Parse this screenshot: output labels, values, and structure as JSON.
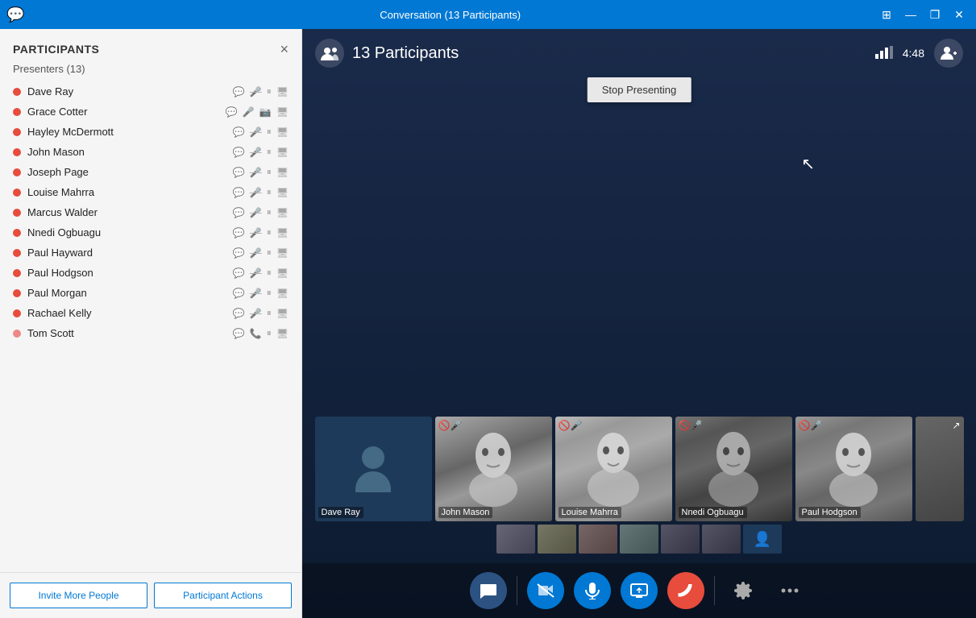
{
  "titlebar": {
    "app_icon": "💬",
    "title": "Conversation (13 Participants)",
    "btn_snap": "⊞",
    "btn_maximize": "□",
    "btn_minimize": "—",
    "btn_restore": "❐",
    "btn_close": "✕"
  },
  "sidebar": {
    "title": "PARTICIPANTS",
    "close_label": "×",
    "presenters_label": "Presenters (13)",
    "participants": [
      {
        "name": "Dave Ray",
        "status": "red"
      },
      {
        "name": "Grace Cotter",
        "status": "red"
      },
      {
        "name": "Hayley McDermott",
        "status": "red"
      },
      {
        "name": "John Mason",
        "status": "red"
      },
      {
        "name": "Joseph Page",
        "status": "red"
      },
      {
        "name": "Louise Mahrra",
        "status": "red"
      },
      {
        "name": "Marcus Walder",
        "status": "red"
      },
      {
        "name": "Nnedi Ogbuagu",
        "status": "red"
      },
      {
        "name": "Paul Hayward",
        "status": "red"
      },
      {
        "name": "Paul Hodgson",
        "status": "red"
      },
      {
        "name": "Paul Morgan",
        "status": "red"
      },
      {
        "name": "Rachael Kelly",
        "status": "red"
      },
      {
        "name": "Tom Scott",
        "status": "red"
      }
    ],
    "invite_btn": "Invite More People",
    "actions_btn": "Participant Actions"
  },
  "video": {
    "participants_count": "13 Participants",
    "timer": "4:48",
    "stop_presenting_btn": "Stop Presenting",
    "tiles": [
      {
        "name": "Dave Ray",
        "type": "avatar",
        "muted": false
      },
      {
        "name": "John Mason",
        "type": "photo",
        "muted": true
      },
      {
        "name": "Louise Mahrra",
        "type": "photo",
        "muted": true
      },
      {
        "name": "Nnedi Ogbuagu",
        "type": "photo",
        "muted": true
      },
      {
        "name": "Paul Hodgson",
        "type": "photo",
        "muted": true
      }
    ]
  },
  "controls": {
    "chat_icon": "💬",
    "video_off_icon": "🎥",
    "mic_icon": "🎤",
    "screen_icon": "🖥",
    "end_icon": "📞",
    "settings_icon": "⚙",
    "more_icon": "•••"
  }
}
